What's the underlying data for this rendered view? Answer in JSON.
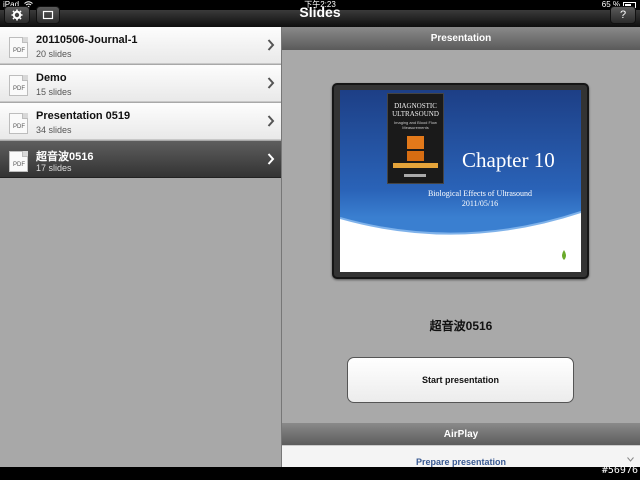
{
  "status_bar": {
    "carrier": "iPad",
    "time": "下午2:23",
    "battery_percent": "65 %",
    "battery_level": 0.65
  },
  "nav_bar": {
    "title": "Slides",
    "left_button_icons": [
      "gear-icon",
      "compose-icon"
    ],
    "right_button_label": "?"
  },
  "sidebar": {
    "items": [
      {
        "name": "20110506-Journal-1",
        "count": "20 slides",
        "icon_label": "PDF",
        "selected": false
      },
      {
        "name": "Demo",
        "count": "15 slides",
        "icon_label": "PDF",
        "selected": false
      },
      {
        "name": "Presentation 0519",
        "count": "34 slides",
        "icon_label": "PDF",
        "selected": false
      },
      {
        "name": "超音波0516",
        "count": "17 slides",
        "icon_label": "PDF",
        "selected": true
      }
    ]
  },
  "detail": {
    "presentation_header": "Presentation",
    "slide": {
      "book_title": "DIAGNOSTIC ULTRASOUND",
      "book_subtitle": "Imaging and Blood Flow Measurements",
      "chapter": "Chapter 10",
      "subtitle": "Biological Effects of Ultrasound",
      "date": "2011/05/16"
    },
    "presentation_name": "超音波0516",
    "start_button": "Start presentation",
    "airplay_header": "AirPlay",
    "prepare_label": "Prepare presentation"
  },
  "watermark": "#56976",
  "colors": {
    "selected_row": "#4a4a4a",
    "accent_blue": "#3a5a92",
    "slide_blue": "#2a63b8"
  }
}
